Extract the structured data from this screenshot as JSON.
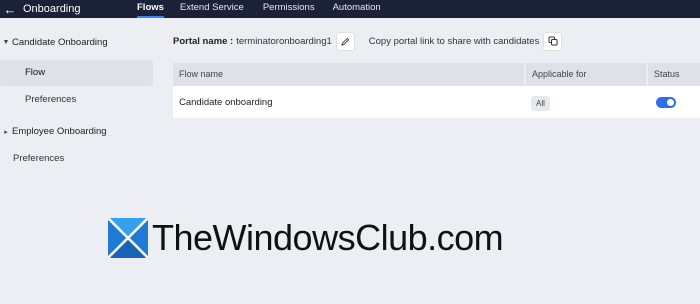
{
  "header": {
    "back_icon": "arrow-left-icon",
    "title": "Onboarding",
    "tabs": [
      {
        "label": "Flows",
        "active": true
      },
      {
        "label": "Extend Service",
        "active": false
      },
      {
        "label": "Permissions",
        "active": false
      },
      {
        "label": "Automation",
        "active": false
      }
    ]
  },
  "sidebar": {
    "candidate_group": {
      "label": "Candidate Onboarding",
      "icon": "chevron-down-icon"
    },
    "candidate_items": [
      {
        "label": "Flow",
        "active": true
      },
      {
        "label": "Preferences",
        "active": false
      }
    ],
    "employee_group": {
      "label": "Employee Onboarding",
      "icon": "chevron-right-icon"
    },
    "preferences": "Preferences"
  },
  "portal": {
    "label": "Portal name :",
    "value": "terminatoronboarding1",
    "edit_icon": "pencil-icon",
    "copy_text": "Copy portal link to share with candidates",
    "copy_icon": "copy-icon"
  },
  "table": {
    "headers": [
      "Flow name",
      "Applicable for",
      "Status"
    ],
    "rows": [
      {
        "name": "Candidate onboarding",
        "applicable": "All",
        "status": "on"
      }
    ]
  },
  "watermark": {
    "text": "TheWindowsClub.com"
  },
  "colors": {
    "topbar": "#1b2137",
    "accent": "#2d6fe8",
    "background": "#eceef3"
  }
}
